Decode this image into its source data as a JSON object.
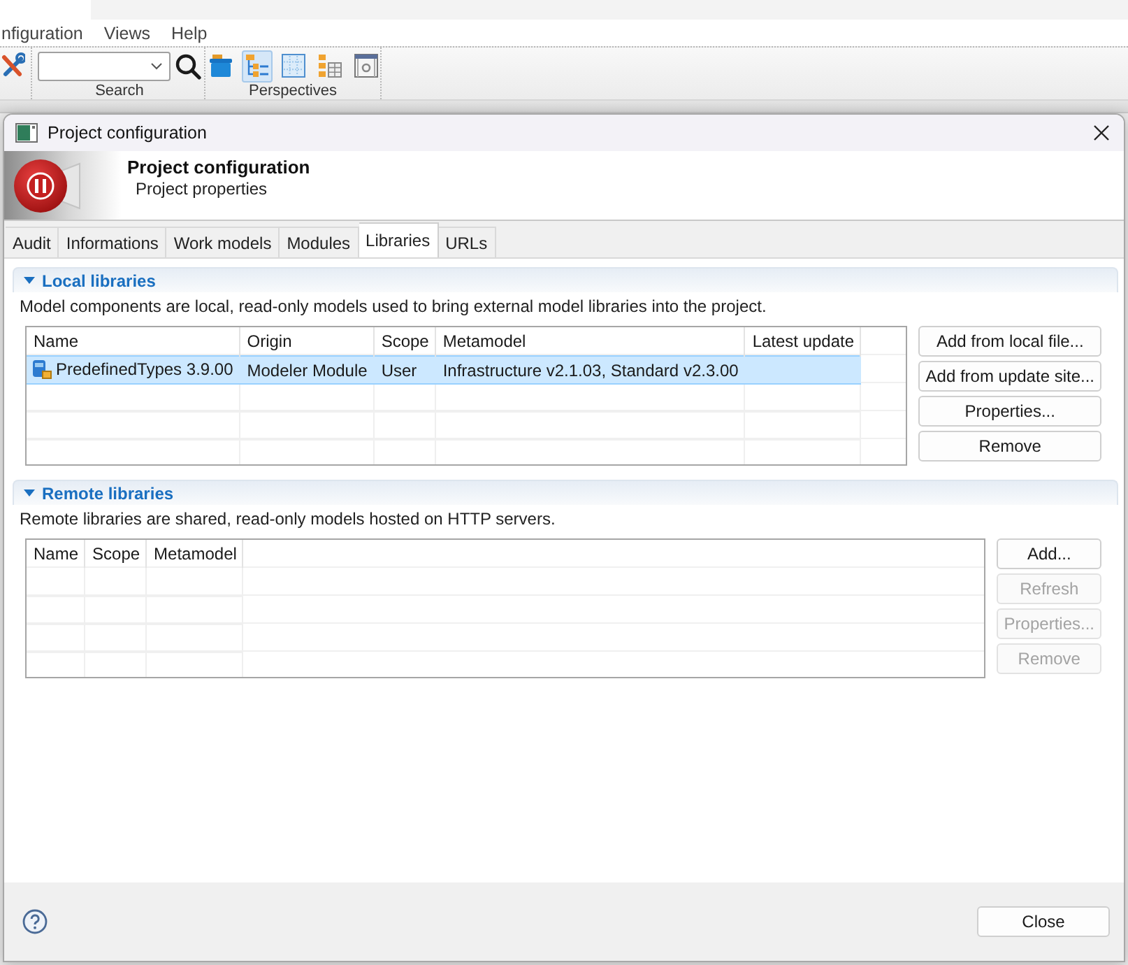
{
  "app": {
    "menu": [
      {
        "label": "nfiguration"
      },
      {
        "label": "Views"
      },
      {
        "label": "Help"
      }
    ],
    "toolbar": {
      "groups": [
        {
          "kind": "search",
          "label": "Search"
        },
        {
          "kind": "perspectives",
          "label": "Perspectives",
          "buttons": [
            {
              "kind": "box",
              "selected": false
            },
            {
              "kind": "tree",
              "selected": true
            },
            {
              "kind": "grid",
              "selected": false
            },
            {
              "kind": "list",
              "selected": false
            },
            {
              "kind": "panel",
              "selected": false
            }
          ]
        }
      ]
    }
  },
  "dialog": {
    "title": "Project configuration",
    "header": {
      "title": "Project configuration",
      "subtitle": "Project properties"
    },
    "tabs": [
      {
        "label": "Audit",
        "selected": false
      },
      {
        "label": "Informations",
        "selected": false
      },
      {
        "label": "Work models",
        "selected": false
      },
      {
        "label": "Modules",
        "selected": false
      },
      {
        "label": "Libraries",
        "selected": true
      },
      {
        "label": "URLs",
        "selected": false
      }
    ],
    "sections": [
      {
        "title": "Local libraries",
        "expanded": true,
        "description": "Model components are local, read-only models used to bring external model libraries into the project.",
        "table": {
          "columns": [
            "Name",
            "Origin",
            "Scope",
            "Metamodel",
            "Latest update"
          ],
          "rows": [
            {
              "cells": [
                "PredefinedTypes 3.9.00",
                "Modeler Module",
                "User",
                "Infrastructure v2.1.03, Standard v2.3.00"
              ],
              "selected": true
            }
          ]
        },
        "buttons": [
          {
            "label": "Add from local file...",
            "disabled": false
          },
          {
            "label": "Add from update site...",
            "disabled": false
          },
          {
            "label": "Properties...",
            "disabled": false
          },
          {
            "label": "Remove",
            "disabled": false
          }
        ]
      },
      {
        "title": "Remote libraries",
        "expanded": true,
        "description": "Remote libraries are shared, read-only models hosted on HTTP servers.",
        "table": {
          "columns": [
            "Name",
            "Scope",
            "Metamodel"
          ]
        },
        "buttons": [
          {
            "label": "Add...",
            "disabled": false
          },
          {
            "label": "Refresh",
            "disabled": true
          },
          {
            "label": "Properties...",
            "disabled": true
          },
          {
            "label": "Remove",
            "disabled": true
          }
        ]
      }
    ],
    "footer": {
      "close_button": "Close"
    }
  }
}
